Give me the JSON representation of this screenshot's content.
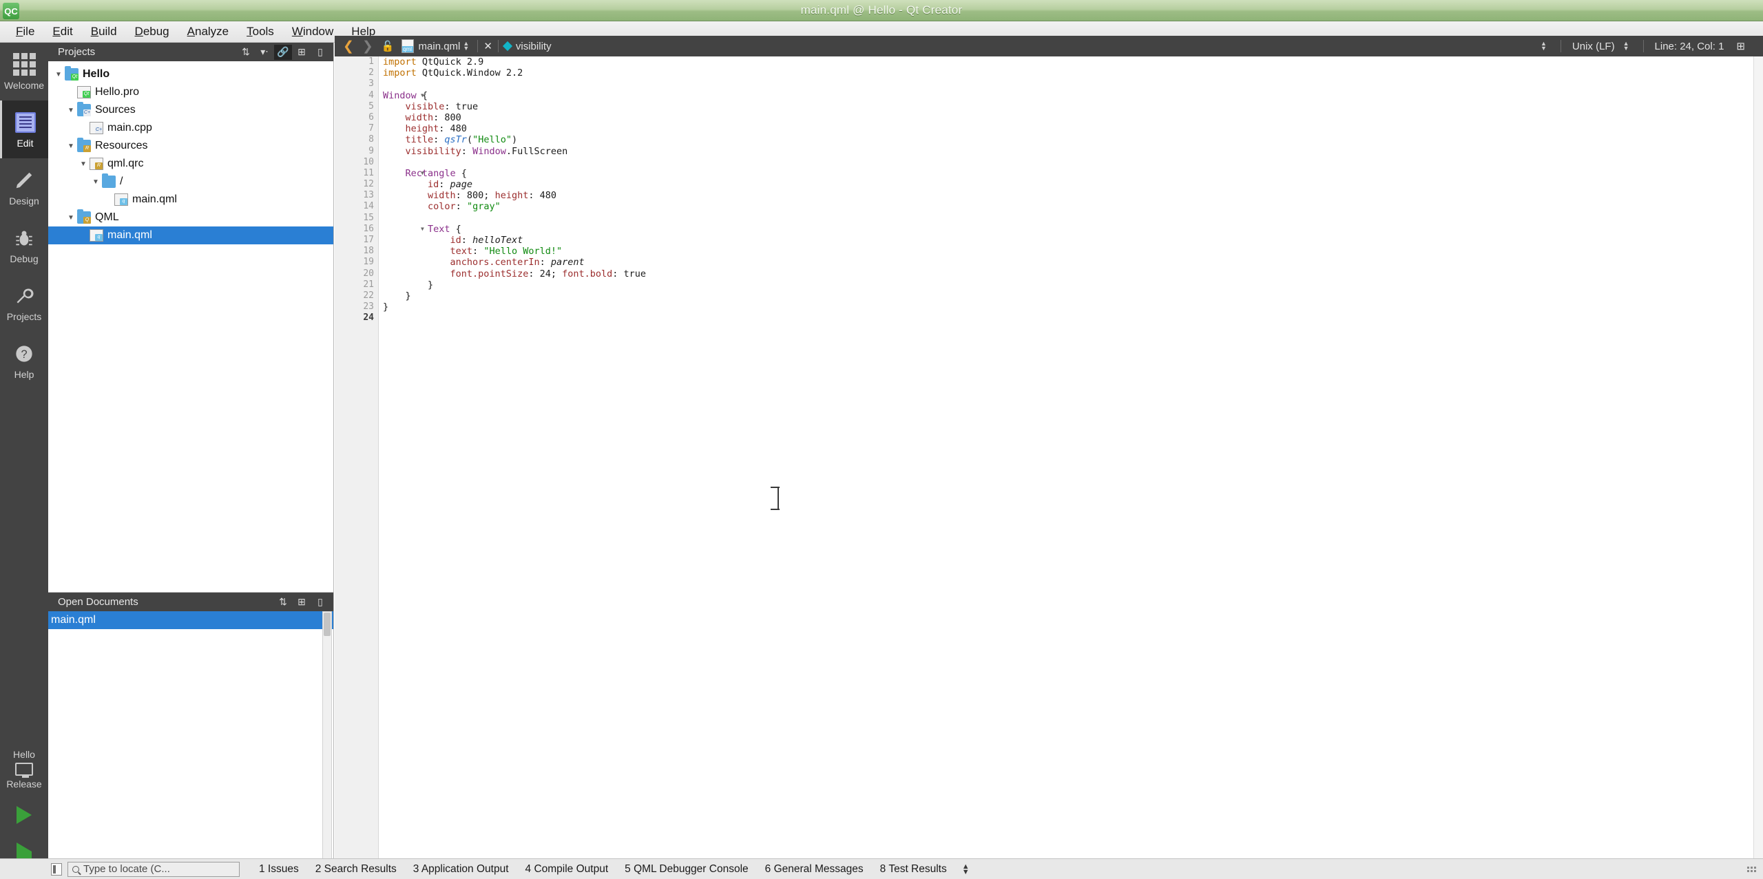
{
  "window": {
    "title": "main.qml @ Hello - Qt Creator",
    "logo": "QC"
  },
  "menubar": {
    "items": [
      {
        "label": "File",
        "mnemonic": "F"
      },
      {
        "label": "Edit",
        "mnemonic": "E"
      },
      {
        "label": "Build",
        "mnemonic": "B"
      },
      {
        "label": "Debug",
        "mnemonic": "D"
      },
      {
        "label": "Analyze",
        "mnemonic": "A"
      },
      {
        "label": "Tools",
        "mnemonic": "T"
      },
      {
        "label": "Window",
        "mnemonic": "W"
      },
      {
        "label": "Help",
        "mnemonic": "H"
      }
    ]
  },
  "modebar": {
    "items": [
      {
        "label": "Welcome",
        "icon": "grid-icon",
        "active": false
      },
      {
        "label": "Edit",
        "icon": "document-lines-icon",
        "active": true
      },
      {
        "label": "Design",
        "icon": "pencil-icon",
        "active": false
      },
      {
        "label": "Debug",
        "icon": "bug-icon",
        "active": false
      },
      {
        "label": "Projects",
        "icon": "wrench-icon",
        "active": false
      },
      {
        "label": "Help",
        "icon": "question-mark-icon",
        "active": false
      }
    ],
    "kit": {
      "project": "Hello",
      "build_config": "Release"
    }
  },
  "projects_pane": {
    "title": "Projects",
    "toolbar_icons": [
      "sort-chevrons-icon",
      "filter-icon",
      "link-icon",
      "split-icon",
      "minimize-icon"
    ],
    "tree": [
      {
        "label": "Hello",
        "indent": 0,
        "arrow": "down",
        "icon": "qt-folder-icon",
        "bold": true,
        "selected": false
      },
      {
        "label": "Hello.pro",
        "indent": 1,
        "arrow": "none",
        "icon": "qt-file-icon",
        "bold": false,
        "selected": false
      },
      {
        "label": "Sources",
        "indent": 1,
        "arrow": "down",
        "icon": "cpp-folder-icon",
        "bold": false,
        "selected": false
      },
      {
        "label": "main.cpp",
        "indent": 2,
        "arrow": "none",
        "icon": "cpp-file-icon",
        "bold": false,
        "selected": false
      },
      {
        "label": "Resources",
        "indent": 1,
        "arrow": "down",
        "icon": "res-folder-icon",
        "bold": false,
        "selected": false
      },
      {
        "label": "qml.qrc",
        "indent": 2,
        "arrow": "down",
        "icon": "qrc-file-icon",
        "bold": false,
        "selected": false
      },
      {
        "label": "/",
        "indent": 3,
        "arrow": "down",
        "icon": "plain-folder-icon",
        "bold": false,
        "selected": false
      },
      {
        "label": "main.qml",
        "indent": 4,
        "arrow": "none",
        "icon": "qml-file-icon",
        "bold": false,
        "selected": false
      },
      {
        "label": "QML",
        "indent": 1,
        "arrow": "down",
        "icon": "qml-folder-icon",
        "bold": false,
        "selected": false
      },
      {
        "label": "main.qml",
        "indent": 2,
        "arrow": "none",
        "icon": "qml-file-icon",
        "bold": false,
        "selected": true
      }
    ]
  },
  "open_documents": {
    "title": "Open Documents",
    "toolbar_icons": [
      "sort-chevrons-icon",
      "split-icon",
      "minimize-icon"
    ],
    "documents": [
      {
        "label": "main.qml",
        "selected": true
      }
    ]
  },
  "editor_toolbar": {
    "back_arrow": "❮",
    "forward_arrow": "❯",
    "lock_icon": "unlocked-icon",
    "file_icon": "qml-file-icon",
    "file_name": "main.qml",
    "close_label": "✕",
    "symbol_icon": "property-diamond-icon",
    "symbol_name": "visibility",
    "line_ending": "Unix (LF)",
    "cursor_position": "Line: 24, Col: 1",
    "split_icon": "split-editor-icon"
  },
  "editor": {
    "total_lines": 24,
    "current_line": 24,
    "fold_lines": [
      4,
      11,
      16
    ],
    "lines": [
      {
        "n": 1,
        "tokens": [
          {
            "t": "import",
            "c": "kw"
          },
          {
            "t": " QtQuick 2.9",
            "c": ""
          }
        ]
      },
      {
        "n": 2,
        "tokens": [
          {
            "t": "import",
            "c": "kw"
          },
          {
            "t": " QtQuick.Window 2.2",
            "c": ""
          }
        ]
      },
      {
        "n": 3,
        "tokens": []
      },
      {
        "n": 4,
        "tokens": [
          {
            "t": "Window",
            "c": "type"
          },
          {
            "t": " {",
            "c": ""
          }
        ]
      },
      {
        "n": 5,
        "tokens": [
          {
            "t": "    visible",
            "c": "prop"
          },
          {
            "t": ": true",
            "c": ""
          }
        ]
      },
      {
        "n": 6,
        "tokens": [
          {
            "t": "    width",
            "c": "prop"
          },
          {
            "t": ": 800",
            "c": ""
          }
        ]
      },
      {
        "n": 7,
        "tokens": [
          {
            "t": "    height",
            "c": "prop"
          },
          {
            "t": ": 480",
            "c": ""
          }
        ]
      },
      {
        "n": 8,
        "tokens": [
          {
            "t": "    title",
            "c": "prop"
          },
          {
            "t": ": ",
            "c": ""
          },
          {
            "t": "qsTr",
            "c": "fn"
          },
          {
            "t": "(",
            "c": ""
          },
          {
            "t": "\"Hello\"",
            "c": "str"
          },
          {
            "t": ")",
            "c": ""
          }
        ]
      },
      {
        "n": 9,
        "tokens": [
          {
            "t": "    visibility",
            "c": "prop"
          },
          {
            "t": ": ",
            "c": ""
          },
          {
            "t": "Window",
            "c": "type"
          },
          {
            "t": ".FullScreen",
            "c": ""
          }
        ]
      },
      {
        "n": 10,
        "tokens": []
      },
      {
        "n": 11,
        "tokens": [
          {
            "t": "    ",
            "c": ""
          },
          {
            "t": "Rectangle",
            "c": "type"
          },
          {
            "t": " {",
            "c": ""
          }
        ]
      },
      {
        "n": 12,
        "tokens": [
          {
            "t": "        id",
            "c": "prop"
          },
          {
            "t": ": ",
            "c": ""
          },
          {
            "t": "page",
            "c": "idv"
          }
        ]
      },
      {
        "n": 13,
        "tokens": [
          {
            "t": "        width",
            "c": "prop"
          },
          {
            "t": ": 800; ",
            "c": ""
          },
          {
            "t": "height",
            "c": "prop"
          },
          {
            "t": ": 480",
            "c": ""
          }
        ]
      },
      {
        "n": 14,
        "tokens": [
          {
            "t": "        color",
            "c": "prop"
          },
          {
            "t": ": ",
            "c": ""
          },
          {
            "t": "\"gray\"",
            "c": "str"
          }
        ]
      },
      {
        "n": 15,
        "tokens": []
      },
      {
        "n": 16,
        "tokens": [
          {
            "t": "        ",
            "c": ""
          },
          {
            "t": "Text",
            "c": "type"
          },
          {
            "t": " {",
            "c": ""
          }
        ]
      },
      {
        "n": 17,
        "tokens": [
          {
            "t": "            id",
            "c": "prop"
          },
          {
            "t": ": ",
            "c": ""
          },
          {
            "t": "helloText",
            "c": "idv"
          }
        ]
      },
      {
        "n": 18,
        "tokens": [
          {
            "t": "            text",
            "c": "prop"
          },
          {
            "t": ": ",
            "c": ""
          },
          {
            "t": "\"Hello World!\"",
            "c": "str"
          }
        ]
      },
      {
        "n": 19,
        "tokens": [
          {
            "t": "            anchors.centerIn",
            "c": "prop"
          },
          {
            "t": ": ",
            "c": ""
          },
          {
            "t": "parent",
            "c": "idv"
          }
        ]
      },
      {
        "n": 20,
        "tokens": [
          {
            "t": "            font.pointSize",
            "c": "prop"
          },
          {
            "t": ": 24; ",
            "c": ""
          },
          {
            "t": "font.bold",
            "c": "prop"
          },
          {
            "t": ": true",
            "c": ""
          }
        ]
      },
      {
        "n": 21,
        "tokens": [
          {
            "t": "        }",
            "c": ""
          }
        ]
      },
      {
        "n": 22,
        "tokens": [
          {
            "t": "    }",
            "c": ""
          }
        ]
      },
      {
        "n": 23,
        "tokens": [
          {
            "t": "}",
            "c": ""
          }
        ]
      },
      {
        "n": 24,
        "tokens": []
      }
    ]
  },
  "statusbar": {
    "locator_placeholder": "Type to locate (C...",
    "panes": [
      {
        "number": "1",
        "label": "Issues"
      },
      {
        "number": "2",
        "label": "Search Results"
      },
      {
        "number": "3",
        "label": "Application Output"
      },
      {
        "number": "4",
        "label": "Compile Output"
      },
      {
        "number": "5",
        "label": "QML Debugger Console"
      },
      {
        "number": "6",
        "label": "General Messages"
      },
      {
        "number": "8",
        "label": "Test Results"
      }
    ]
  },
  "colors": {
    "titlebar_green": "#9dbd85",
    "selection_blue": "#2a7fd4",
    "dark_chrome": "#434343",
    "keyword_orange": "#c07000",
    "type_purple": "#8a2f8a",
    "property_red": "#9b2d2d",
    "string_green": "#108a10",
    "accent_cyan": "#12b5c8",
    "run_green": "#3aa03a"
  }
}
